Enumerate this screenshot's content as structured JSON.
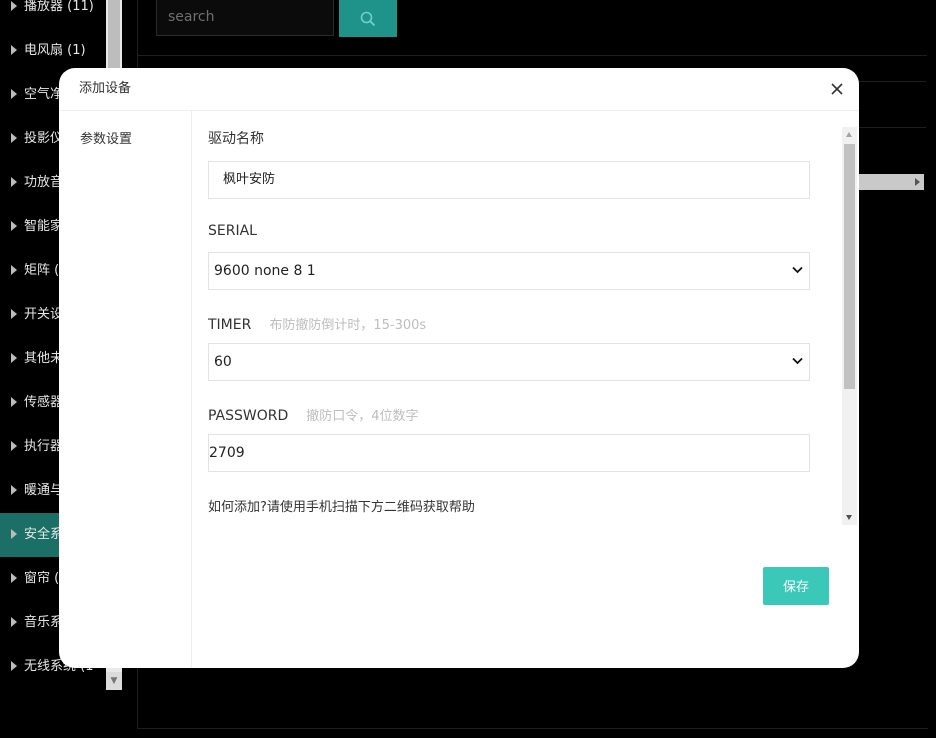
{
  "sidebar": {
    "items": [
      {
        "label": "播放器 (11)"
      },
      {
        "label": "电风扇 (1)"
      },
      {
        "label": "空气净"
      },
      {
        "label": "投影仪"
      },
      {
        "label": "功放音"
      },
      {
        "label": "智能家"
      },
      {
        "label": "矩阵 ("
      },
      {
        "label": "开关设"
      },
      {
        "label": "其他未"
      },
      {
        "label": "传感器"
      },
      {
        "label": "执行器"
      },
      {
        "label": "暖通与"
      },
      {
        "label": "安全系"
      },
      {
        "label": "窗帘 ("
      },
      {
        "label": "音乐系"
      },
      {
        "label": "无线系统 (1"
      }
    ],
    "active_index": 12
  },
  "search": {
    "placeholder": "search"
  },
  "modal": {
    "title": "添加设备",
    "nav_item": "参数设置",
    "fields": {
      "driver_name": {
        "label": "驱动名称",
        "value": "枫叶安防"
      },
      "serial": {
        "label": "SERIAL",
        "value": "9600 none 8 1"
      },
      "timer": {
        "label": "TIMER",
        "hint": "布防撤防倒计时，15-300s",
        "value": "60"
      },
      "password": {
        "label": "PASSWORD",
        "hint": "撤防口令，4位数字",
        "value": "2709"
      }
    },
    "help_text": "如何添加?请使用手机扫描下方二维码获取帮助",
    "save_label": "保存"
  },
  "colors": {
    "accent": "#3cc8b9",
    "search_button": "#1f938a",
    "active_sidebar": "#1c6f66",
    "hint_text": "#bdbdbd"
  },
  "icons": {
    "close": "close-icon",
    "search": "search-icon",
    "dropdown": "chevron-down-icon",
    "sidebar_expand": "caret-right-icon"
  }
}
